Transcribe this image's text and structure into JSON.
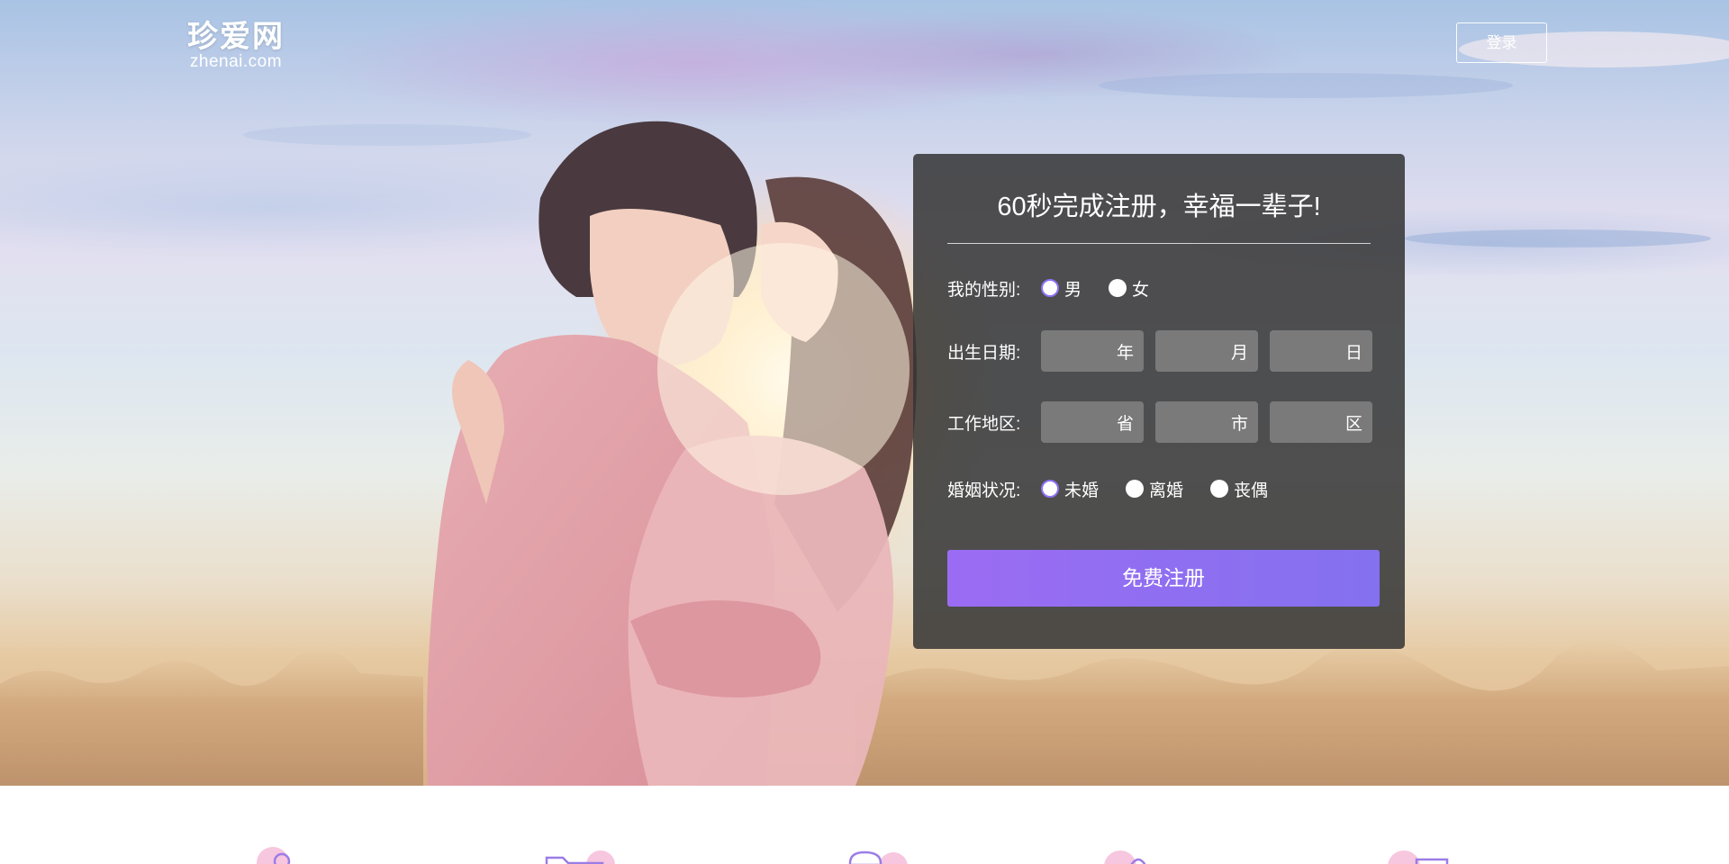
{
  "brand": {
    "name_cn": "珍爱网",
    "domain": "zhenai.com"
  },
  "header": {
    "login_label": "登录"
  },
  "registration": {
    "title": "60秒完成注册，幸福一辈子!",
    "gender": {
      "label": "我的性别:",
      "options": [
        "男",
        "女"
      ],
      "selected": "男"
    },
    "birth_date": {
      "label": "出生日期:",
      "fields": [
        "年",
        "月",
        "日"
      ]
    },
    "work_area": {
      "label": "工作地区:",
      "fields": [
        "省",
        "市",
        "区"
      ]
    },
    "marital_status": {
      "label": "婚姻状况:",
      "options": [
        "未婚",
        "离婚",
        "丧偶"
      ],
      "selected": "未婚"
    },
    "submit_label": "免费注册"
  },
  "colors": {
    "accent": "#8e72f2",
    "panel_bg": "#343434",
    "button_start": "#9b6cf3",
    "button_end": "#8471ef",
    "feature_icon_pink": "#f7c6df",
    "feature_icon_purple": "#9b7de6"
  },
  "features": [
    {
      "icon": "user-icon"
    },
    {
      "icon": "folder-icon"
    },
    {
      "icon": "person-shield-icon"
    },
    {
      "icon": "lotus-icon"
    },
    {
      "icon": "document-icon"
    }
  ]
}
